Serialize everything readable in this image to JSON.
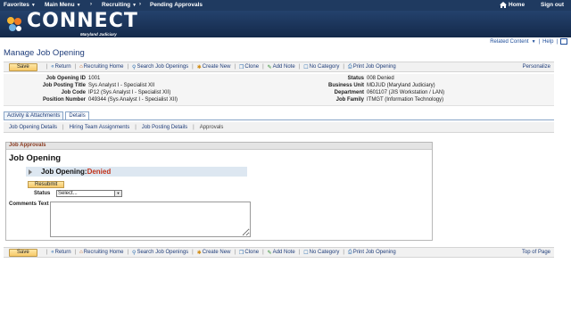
{
  "nav": {
    "favorites": "Favorites",
    "main_menu": "Main Menu",
    "crumb1": "Recruiting",
    "crumb2": "Pending Approvals",
    "home": "Home",
    "signout": "Sign out",
    "caret": "▼",
    "sep": "›"
  },
  "banner": {
    "logo_text": "CONNECT",
    "logo_sub": "Maryland Judiciary"
  },
  "utility": {
    "related_content": "Related Content",
    "help": "Help"
  },
  "page_title": "Manage Job Opening",
  "toolbar": {
    "save": "Save",
    "return": "Return",
    "recruiting_home": "Recruiting Home",
    "search_job_openings": "Search Job Openings",
    "create_new": "Create New",
    "clone": "Clone",
    "add_note": "Add Note",
    "no_category": "No Category",
    "print_job_opening": "Print Job Opening",
    "personalize": "Personalize",
    "top_of_page": "Top of Page"
  },
  "info": {
    "job_opening_id": {
      "label": "Job Opening ID",
      "value": "1001"
    },
    "job_posting_title": {
      "label": "Job Posting Title",
      "value": "Sys Analyst I - Specialist XII"
    },
    "job_code": {
      "label": "Job Code",
      "value": "IP12 (Sys Analyst I - Specialist XII)"
    },
    "position_number": {
      "label": "Position Number",
      "value": "049344 (Sys Analyst I - Specialist XII)"
    },
    "status": {
      "label": "Status",
      "value": "008 Denied"
    },
    "business_unit": {
      "label": "Business Unit",
      "value": "MDJUD (Maryland Judiciary)"
    },
    "department": {
      "label": "Department",
      "value": "0601107 (JIS Workstation / LAN)"
    },
    "job_family": {
      "label": "Job Family",
      "value": "ITMGT (Information Technology)"
    }
  },
  "tabs": [
    "Activity & Attachments",
    "Details"
  ],
  "subtabs": [
    "Job Opening Details",
    "Hiring Team Assignments",
    "Job Posting Details",
    "Approvals"
  ],
  "approvals": {
    "section_header": "Job Approvals",
    "title": "Job Opening",
    "bar_label": "Job Opening:",
    "bar_status": "Denied",
    "resubmit": "Resubmit",
    "status_label": "Status",
    "status_value": "Select...",
    "comments_label": "Comments Text"
  },
  "colors": {
    "nav_bg": "#1f3a60",
    "link": "#1f3d7a",
    "denied": "#c0321a",
    "button": "#f7c969"
  }
}
